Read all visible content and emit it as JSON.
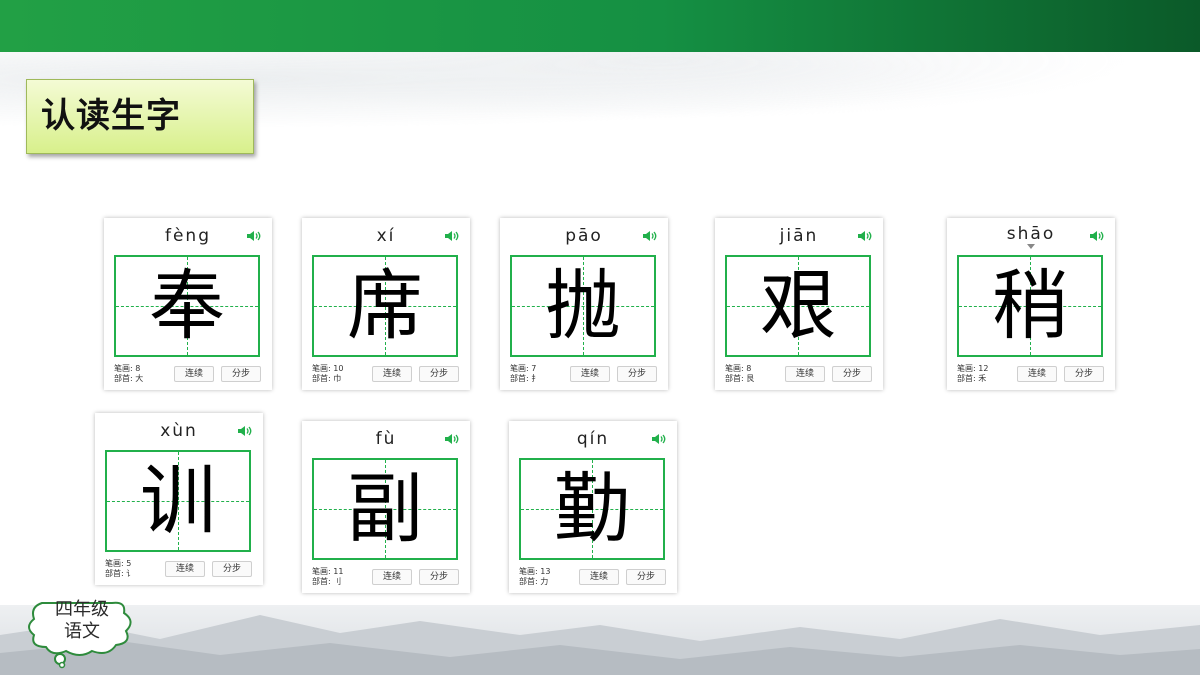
{
  "section_title": "认读生字",
  "footer": {
    "badge_lines": [
      "四年级",
      "语文"
    ]
  },
  "cards": [
    {
      "pinyin": "fèng",
      "char": "奉",
      "strokes": "笔画: 8",
      "radical": "部首: 大",
      "btn_continuous": "连续",
      "btn_step": "分步"
    },
    {
      "pinyin": "xí",
      "char": "席",
      "strokes": "笔画: 10",
      "radical": "部首: 巾",
      "btn_continuous": "连续",
      "btn_step": "分步"
    },
    {
      "pinyin": "pāo",
      "char": "抛",
      "strokes": "笔画: 7",
      "radical": "部首: 扌",
      "btn_continuous": "连续",
      "btn_step": "分步"
    },
    {
      "pinyin": "jiān",
      "char": "艰",
      "strokes": "笔画: 8",
      "radical": "部首: 艮",
      "btn_continuous": "连续",
      "btn_step": "分步"
    },
    {
      "pinyin": "shāo",
      "char": "稍",
      "strokes": "笔画: 12",
      "radical": "部首: 禾",
      "btn_continuous": "连续",
      "btn_step": "分步"
    },
    {
      "pinyin": "xùn",
      "char": "训",
      "strokes": "笔画: 5",
      "radical": "部首: 讠",
      "btn_continuous": "连续",
      "btn_step": "分步"
    },
    {
      "pinyin": "fù",
      "char": "副",
      "strokes": "笔画: 11",
      "radical": "部首: 刂",
      "btn_continuous": "连续",
      "btn_step": "分步"
    },
    {
      "pinyin": "qín",
      "char": "勤",
      "strokes": "笔画: 13",
      "radical": "部首: 力",
      "btn_continuous": "连续",
      "btn_step": "分步"
    }
  ],
  "colors": {
    "header_green": "#159043",
    "grid_green": "#21b04b",
    "label_bg": "#d8f08c"
  },
  "icons": {
    "speaker": "speaker-icon"
  }
}
